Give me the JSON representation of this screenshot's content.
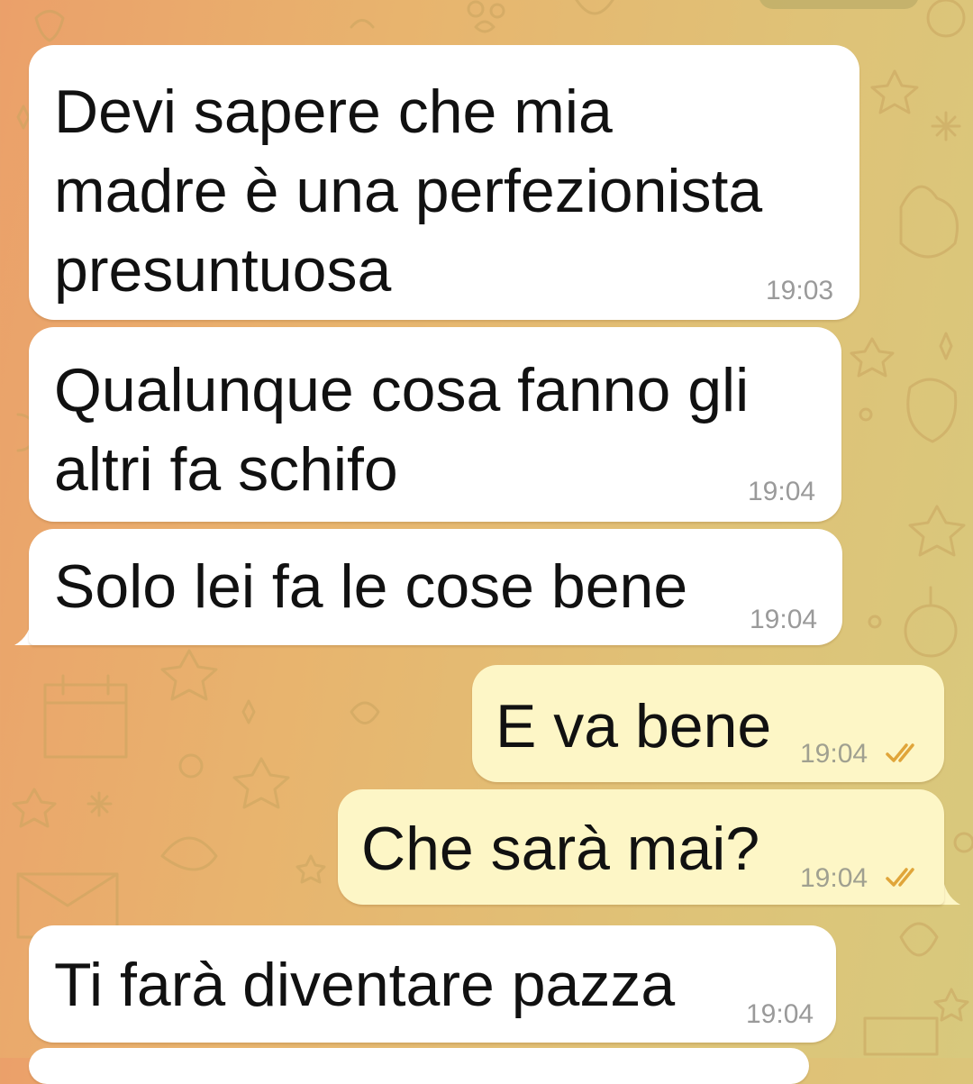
{
  "chat": {
    "messages": [
      {
        "direction": "incoming",
        "lines": [
          "Devi sapere che mia",
          "madre è una perfezionista",
          "presuntuosa"
        ],
        "time": "19:03"
      },
      {
        "direction": "incoming",
        "lines": [
          "Qualunque cosa fanno gli",
          "altri fa schifo"
        ],
        "time": "19:04"
      },
      {
        "direction": "incoming",
        "lines": [
          "Solo lei fa le cose bene"
        ],
        "time": "19:04"
      },
      {
        "direction": "outgoing",
        "lines": [
          "E va bene"
        ],
        "time": "19:04",
        "status": "read-double-check-icon"
      },
      {
        "direction": "outgoing",
        "lines": [
          "Che sarà mai?"
        ],
        "time": "19:04",
        "status": "read-double-check-icon"
      },
      {
        "direction": "incoming",
        "lines": [
          "Ti farà diventare pazza"
        ],
        "time": "19:04"
      }
    ]
  },
  "colors": {
    "incoming_bubble": "#ffffff",
    "outgoing_bubble": "#fdf6c6",
    "read_check": "#e0a53a",
    "wallpaper_from": "#eba06a",
    "wallpaper_to": "#d8c97d"
  },
  "icons": [
    "read-double-check-icon",
    "wallpaper-doodle-pattern"
  ]
}
